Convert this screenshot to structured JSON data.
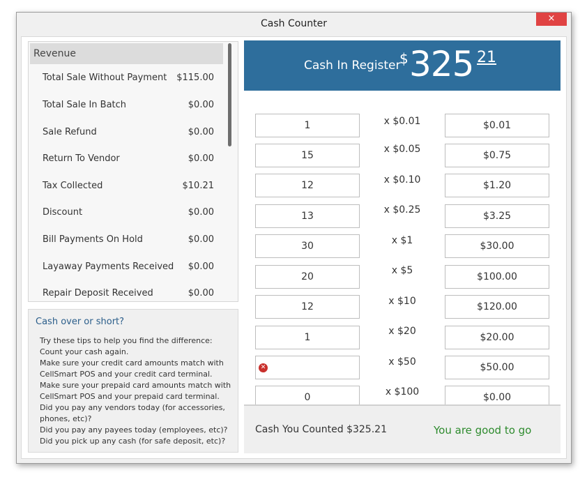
{
  "window": {
    "title": "Cash Counter",
    "close_label": "×"
  },
  "revenue": {
    "header": "Revenue",
    "items": [
      {
        "label": "Total Sale Without Payment",
        "value": "$115.00"
      },
      {
        "label": "Total Sale In Batch",
        "value": "$0.00"
      },
      {
        "label": "Sale Refund",
        "value": "$0.00"
      },
      {
        "label": "Return To Vendor",
        "value": "$0.00"
      },
      {
        "label": "Tax Collected",
        "value": "$10.21"
      },
      {
        "label": "Discount",
        "value": "$0.00"
      },
      {
        "label": "Bill Payments On Hold",
        "value": "$0.00"
      },
      {
        "label": "Layaway Payments Received",
        "value": "$0.00"
      },
      {
        "label": "Repair Deposit Received",
        "value": "$0.00"
      }
    ]
  },
  "tips": {
    "title": "Cash over or short?",
    "lines": [
      "Try these tips to help you find the difference:",
      "Count your cash again.",
      "Make sure your credit card amounts match with",
      "CellSmart POS and your credit card terminal.",
      "Make sure your prepaid card amounts match with",
      "CellSmart POS and your prepaid card terminal.",
      "Did you pay any vendors today (for accessories,",
      "phones, etc)?",
      "Did you pay any payees today (employees, etc)?",
      "Did you pick up any cash (for safe deposit, etc)?"
    ]
  },
  "register": {
    "label": "Cash In Register",
    "currency_symbol": "$",
    "amount_whole": "325",
    "amount_cents": "21"
  },
  "denominations": [
    {
      "count": "1",
      "label": "x $0.01",
      "total": "$0.01",
      "error": false
    },
    {
      "count": "15",
      "label": "x $0.05",
      "total": "$0.75",
      "error": false
    },
    {
      "count": "12",
      "label": "x $0.10",
      "total": "$1.20",
      "error": false
    },
    {
      "count": "13",
      "label": "x $0.25",
      "total": "$3.25",
      "error": false
    },
    {
      "count": "30",
      "label": "x $1",
      "total": "$30.00",
      "error": false
    },
    {
      "count": "20",
      "label": "x $5",
      "total": "$100.00",
      "error": false
    },
    {
      "count": "12",
      "label": "x $10",
      "total": "$120.00",
      "error": false
    },
    {
      "count": "1",
      "label": "x $20",
      "total": "$20.00",
      "error": false
    },
    {
      "count": "",
      "label": "x $50",
      "total": "$50.00",
      "error": true
    },
    {
      "count": "0",
      "label": "x $100",
      "total": "$0.00",
      "error": false
    }
  ],
  "summary": {
    "counted_text": "Cash You Counted $325.21",
    "status": "You are good to go"
  },
  "colors": {
    "accent": "#2e6e9c",
    "status_ok": "#2e8b2e",
    "close": "#e04343",
    "error": "#c9302c"
  }
}
